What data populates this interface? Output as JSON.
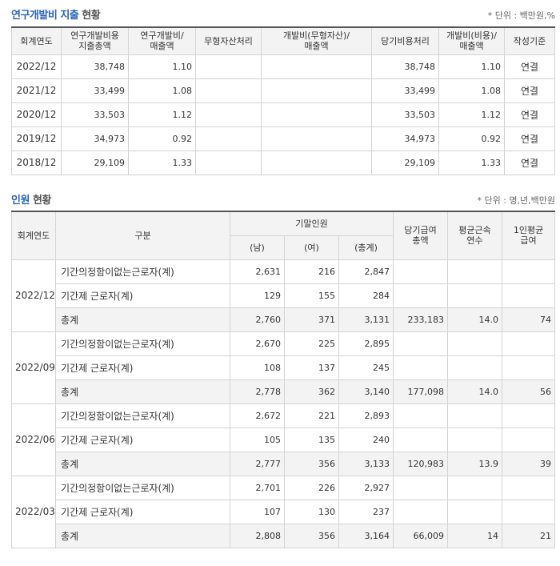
{
  "rd": {
    "title_highlight": "연구개발비 지출",
    "title_rest": " 현황",
    "unit": "* 단위 : 백만원,%",
    "headers": {
      "year": "회계연도",
      "total_spend": "연구개발비용\n지출총액",
      "ratio": "연구개발비/\n매출액",
      "intangible": "무형자산처리",
      "dev_ratio": "개발비(무형자산)/\n매출액",
      "expense": "당기비용처리",
      "dev_expense_ratio": "개발비(비용)/\n매출액",
      "basis": "작성기준"
    },
    "rows": [
      {
        "year": "2022/12",
        "total_spend": "38,748",
        "ratio": "1.10",
        "intangible": "",
        "dev_ratio": "",
        "expense": "38,748",
        "dev_expense_ratio": "1.10",
        "basis": "연결"
      },
      {
        "year": "2021/12",
        "total_spend": "33,499",
        "ratio": "1.08",
        "intangible": "",
        "dev_ratio": "",
        "expense": "33,499",
        "dev_expense_ratio": "1.08",
        "basis": "연결"
      },
      {
        "year": "2020/12",
        "total_spend": "33,503",
        "ratio": "1.12",
        "intangible": "",
        "dev_ratio": "",
        "expense": "33,503",
        "dev_expense_ratio": "1.12",
        "basis": "연결"
      },
      {
        "year": "2019/12",
        "total_spend": "34,973",
        "ratio": "0.92",
        "intangible": "",
        "dev_ratio": "",
        "expense": "34,973",
        "dev_expense_ratio": "0.92",
        "basis": "연결"
      },
      {
        "year": "2018/12",
        "total_spend": "29,109",
        "ratio": "1.33",
        "intangible": "",
        "dev_ratio": "",
        "expense": "29,109",
        "dev_expense_ratio": "1.33",
        "basis": "연결"
      }
    ]
  },
  "hr": {
    "title_highlight": "인원",
    "title_rest": " 현황",
    "unit": "* 단위 : 명,년,백만원",
    "headers": {
      "year": "회계연도",
      "category": "구분",
      "headcount": "기말인원",
      "male": "(남)",
      "female": "(여)",
      "total": "(총계)",
      "salary_total": "당기급여\n총액",
      "avg_tenure": "평균근속\n연수",
      "avg_salary": "1인평균\n급여"
    },
    "groups": [
      {
        "year": "2022/12",
        "rows": [
          {
            "label": "기간의정함이없는근로자(계)",
            "male": "2,631",
            "female": "216",
            "total": "2,847",
            "salary": "",
            "tenure": "",
            "avg": ""
          },
          {
            "label": "기간제 근로자(계)",
            "male": "129",
            "female": "155",
            "total": "284",
            "salary": "",
            "tenure": "",
            "avg": ""
          },
          {
            "label": "총계",
            "male": "2,760",
            "female": "371",
            "total": "3,131",
            "salary": "233,183",
            "tenure": "14.0",
            "avg": "74"
          }
        ]
      },
      {
        "year": "2022/09",
        "rows": [
          {
            "label": "기간의정함이없는근로자(계)",
            "male": "2,670",
            "female": "225",
            "total": "2,895",
            "salary": "",
            "tenure": "",
            "avg": ""
          },
          {
            "label": "기간제 근로자(계)",
            "male": "108",
            "female": "137",
            "total": "245",
            "salary": "",
            "tenure": "",
            "avg": ""
          },
          {
            "label": "총계",
            "male": "2,778",
            "female": "362",
            "total": "3,140",
            "salary": "177,098",
            "tenure": "14.0",
            "avg": "56"
          }
        ]
      },
      {
        "year": "2022/06",
        "rows": [
          {
            "label": "기간의정함이없는근로자(계)",
            "male": "2,672",
            "female": "221",
            "total": "2,893",
            "salary": "",
            "tenure": "",
            "avg": ""
          },
          {
            "label": "기간제 근로자(계)",
            "male": "105",
            "female": "135",
            "total": "240",
            "salary": "",
            "tenure": "",
            "avg": ""
          },
          {
            "label": "총계",
            "male": "2,777",
            "female": "356",
            "total": "3,133",
            "salary": "120,983",
            "tenure": "13.9",
            "avg": "39"
          }
        ]
      },
      {
        "year": "2022/03",
        "rows": [
          {
            "label": "기간의정함이없는근로자(계)",
            "male": "2,701",
            "female": "226",
            "total": "2,927",
            "salary": "",
            "tenure": "",
            "avg": ""
          },
          {
            "label": "기간제 근로자(계)",
            "male": "107",
            "female": "130",
            "total": "237",
            "salary": "",
            "tenure": "",
            "avg": ""
          },
          {
            "label": "총계",
            "male": "2,808",
            "female": "356",
            "total": "3,164",
            "salary": "66,009",
            "tenure": "14",
            "avg": "21"
          }
        ]
      }
    ]
  }
}
